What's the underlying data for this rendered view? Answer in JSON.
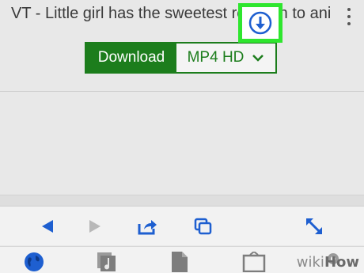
{
  "video": {
    "title": "VT - Little girl has the sweetest reaction to animate..."
  },
  "download": {
    "button_label": "Download",
    "format_value": "MP4  HD"
  },
  "toolbar": {
    "buttons": [
      "back-arrow-icon",
      "forward-arrow-icon",
      "share-icon",
      "tabs-icon",
      "download-icon",
      "fullscreen-icon"
    ]
  },
  "tabbar": {
    "items": [
      "globe-icon",
      "music-icon",
      "document-icon",
      "folder-icon",
      "settings-icon"
    ]
  },
  "watermark": {
    "wiki": "wiki",
    "how": "How"
  },
  "colors": {
    "accent_green": "#1c7d1c",
    "highlight_green": "#2ee62e",
    "icon_blue": "#1e5fd0"
  }
}
